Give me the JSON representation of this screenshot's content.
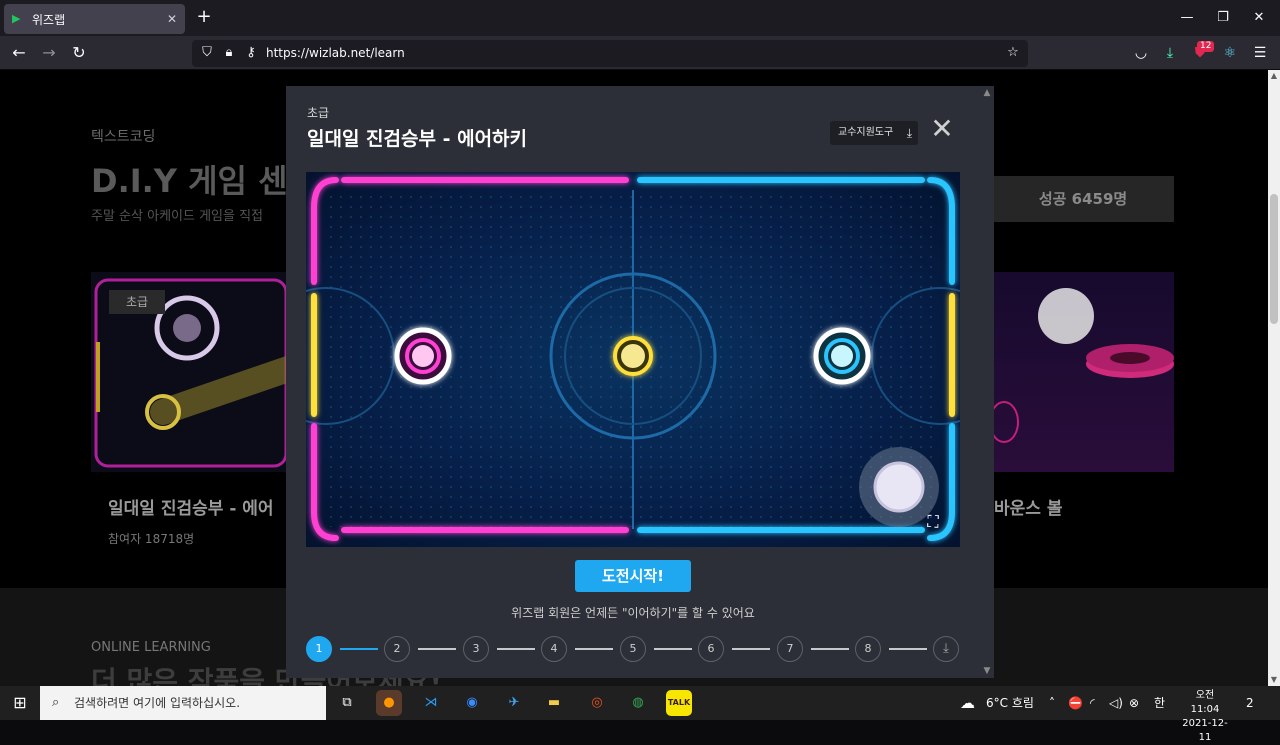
{
  "browser": {
    "tab_title": "위즈랩",
    "tab_close": "✕",
    "new_tab": "+",
    "url": "https://wizlab.net/learn",
    "extension_badge": "12",
    "window_controls": [
      "—",
      "❐",
      "✕"
    ]
  },
  "background_page": {
    "category": "텍스트코딩",
    "headline": "D.I.Y 게임 센터",
    "subtitle": "주말 순삭 아케이드 게임을 직접",
    "success_count": "성공 6459명",
    "card_left_level": "초급",
    "card_left_title": "일대일 진검승부 - 에어",
    "card_left_count": "참여자 18718명",
    "card_right_title": "바운스 볼",
    "online_label": "ONLINE LEARNING",
    "bottom_headline": "더 많은 작품을 만들어보세요!"
  },
  "modal": {
    "level": "초급",
    "title": "일대일 진검승부 - 에어하키",
    "teacher_tool": "교수지원도구",
    "close_icon": "✕",
    "start_button": "도전시작!",
    "note": "위즈랩 회원은 언제든 \"이어하기\"를 할 수 있어요",
    "steps": [
      "1",
      "2",
      "3",
      "4",
      "5",
      "6",
      "7",
      "8"
    ],
    "active_step": "1",
    "game": {
      "colors": {
        "magenta": "#ff3fd2",
        "cyan": "#2bc4ff",
        "yellow": "#ffe03a",
        "field": "#0a3360"
      }
    }
  },
  "taskbar": {
    "search_placeholder": "검색하려면 여기에 입력하십시오.",
    "weather": "6°C  흐림",
    "ime": "한",
    "time": "오전 11:04",
    "date": "2021-12-11",
    "notifications": "2"
  }
}
